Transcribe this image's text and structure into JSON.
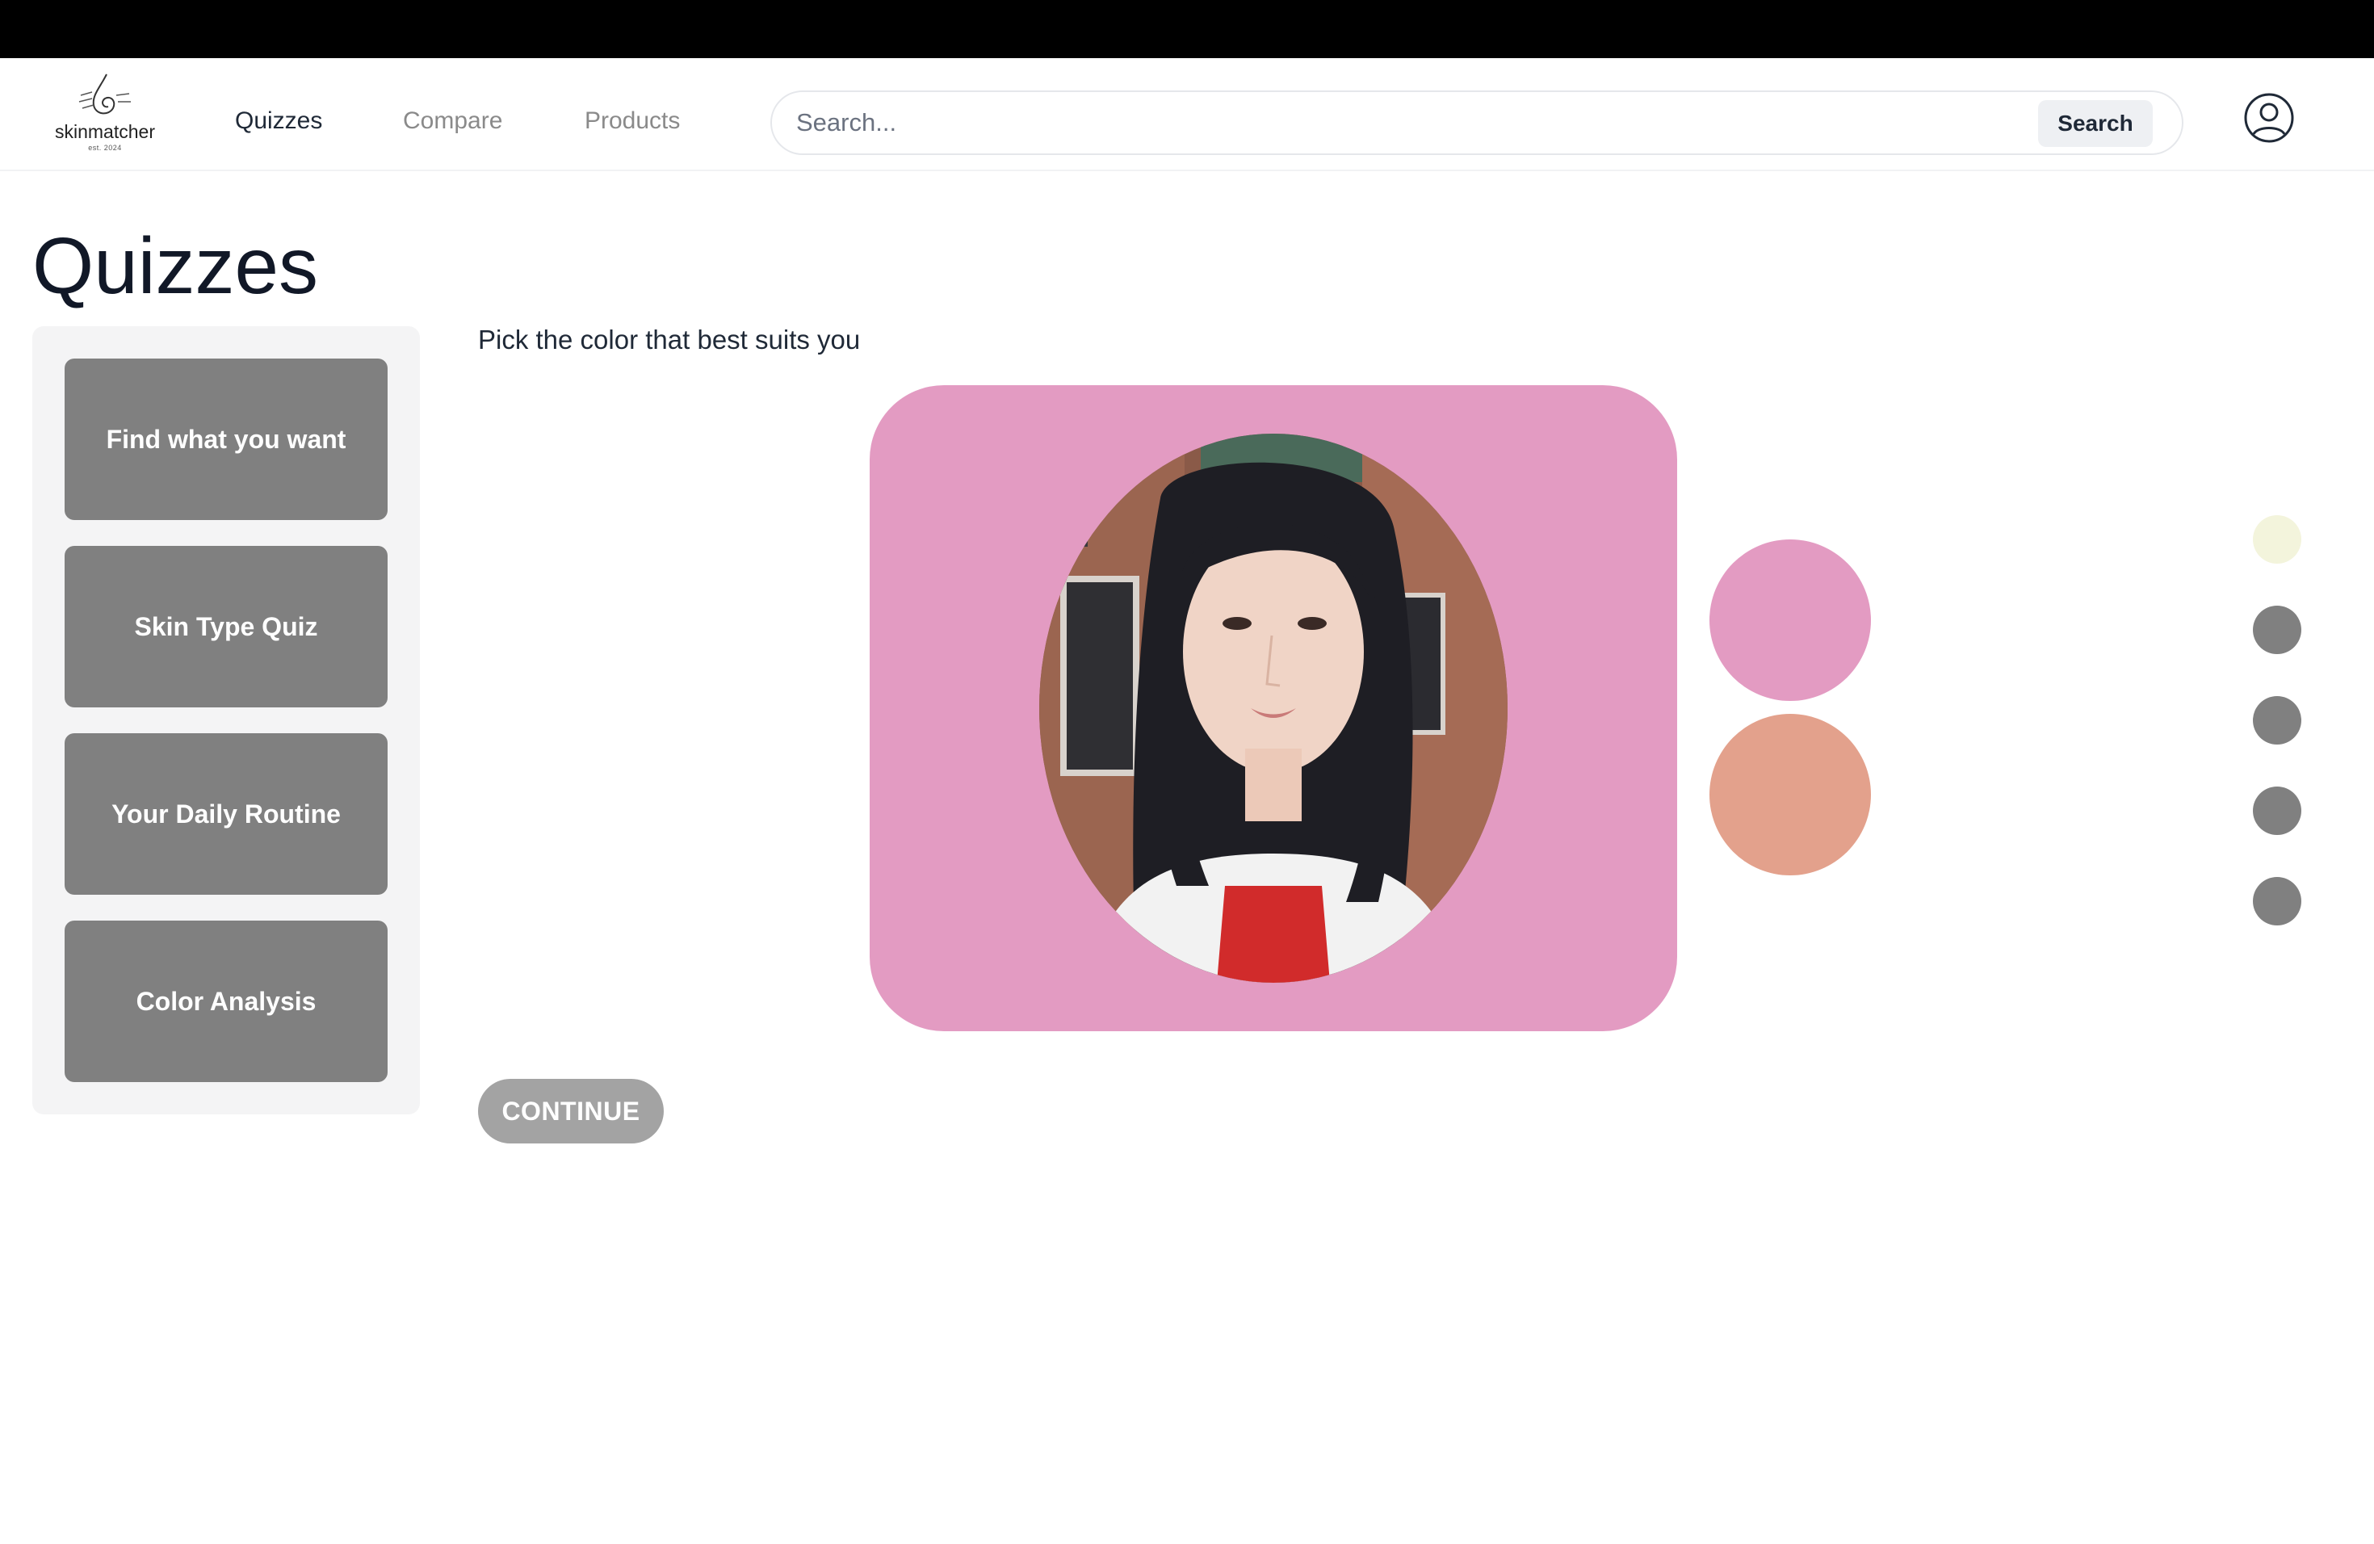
{
  "brand": {
    "name": "skinmatcher",
    "tagline": "est. 2024"
  },
  "nav": {
    "items": [
      {
        "label": "Quizzes",
        "active": true
      },
      {
        "label": "Compare",
        "active": false
      },
      {
        "label": "Products",
        "active": false
      }
    ]
  },
  "search": {
    "placeholder": "Search...",
    "value": "",
    "button_label": "Search"
  },
  "header": {
    "account_icon": "user-circle-icon"
  },
  "page": {
    "title": "Quizzes"
  },
  "sidebar": {
    "quizzes": [
      {
        "label": "Find what you want"
      },
      {
        "label": "Skin Type Quiz"
      },
      {
        "label": "Your Daily Routine"
      },
      {
        "label": "Color Analysis"
      }
    ]
  },
  "quiz": {
    "prompt": "Pick the color that best suits you",
    "preview_background": "#e39bc2",
    "swatches": [
      {
        "color": "#e39bc2"
      },
      {
        "color": "#e3a18c"
      }
    ],
    "steps": [
      {
        "color": "#f3f4dc",
        "current": true
      },
      {
        "color": "#808080",
        "current": false
      },
      {
        "color": "#808080",
        "current": false
      },
      {
        "color": "#808080",
        "current": false
      },
      {
        "color": "#808080",
        "current": false
      }
    ],
    "continue_label": "CONTINUE"
  },
  "colors": {
    "topbar": "#000000",
    "card_gray": "#808080",
    "button_disabled": "#a3a3a3"
  }
}
